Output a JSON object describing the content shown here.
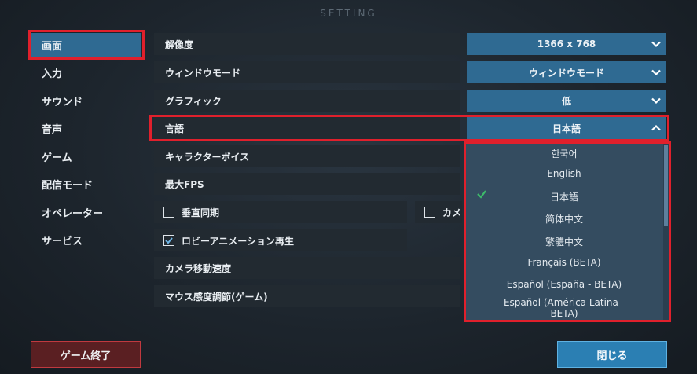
{
  "title": "SETTING",
  "sidebar": {
    "items": [
      {
        "label": "画面"
      },
      {
        "label": "入力"
      },
      {
        "label": "サウンド"
      },
      {
        "label": "音声"
      },
      {
        "label": "ゲーム"
      },
      {
        "label": "配信モード"
      },
      {
        "label": "オペレーター"
      },
      {
        "label": "サービス"
      }
    ]
  },
  "settings": {
    "resolution": {
      "label": "解像度",
      "value": "1366 x 768"
    },
    "window_mode": {
      "label": "ウィンドウモード",
      "value": "ウィンドウモード"
    },
    "graphics": {
      "label": "グラフィック",
      "value": "低"
    },
    "language": {
      "label": "言語",
      "value": "日本語"
    },
    "character_voice": {
      "label": "キャラクターボイス"
    },
    "max_fps": {
      "label": "最大FPS"
    },
    "vsync": {
      "label": "垂直同期",
      "checked": false
    },
    "camera_check": {
      "label": "カメ",
      "checked": false
    },
    "lobby_animation": {
      "label": "ロビーアニメーション再生",
      "checked": true
    },
    "camera_speed": {
      "label": "カメラ移動速度"
    },
    "mouse_sensitivity": {
      "label": "マウス感度調節(ゲーム)"
    }
  },
  "language_dropdown": {
    "options": [
      {
        "label": "한국어"
      },
      {
        "label": "English"
      },
      {
        "label": "日本語",
        "selected": true
      },
      {
        "label": "简体中文"
      },
      {
        "label": "繁體中文"
      },
      {
        "label": "Français (BETA)"
      },
      {
        "label": "Español (España - BETA)"
      },
      {
        "label": "Español (América Latina - BETA)"
      }
    ]
  },
  "buttons": {
    "exit_game": "ゲーム終了",
    "close": "閉じる"
  },
  "colors": {
    "accent": "#2f6a92",
    "highlight_border": "#e0202c",
    "check_green": "#3dbb6a"
  }
}
